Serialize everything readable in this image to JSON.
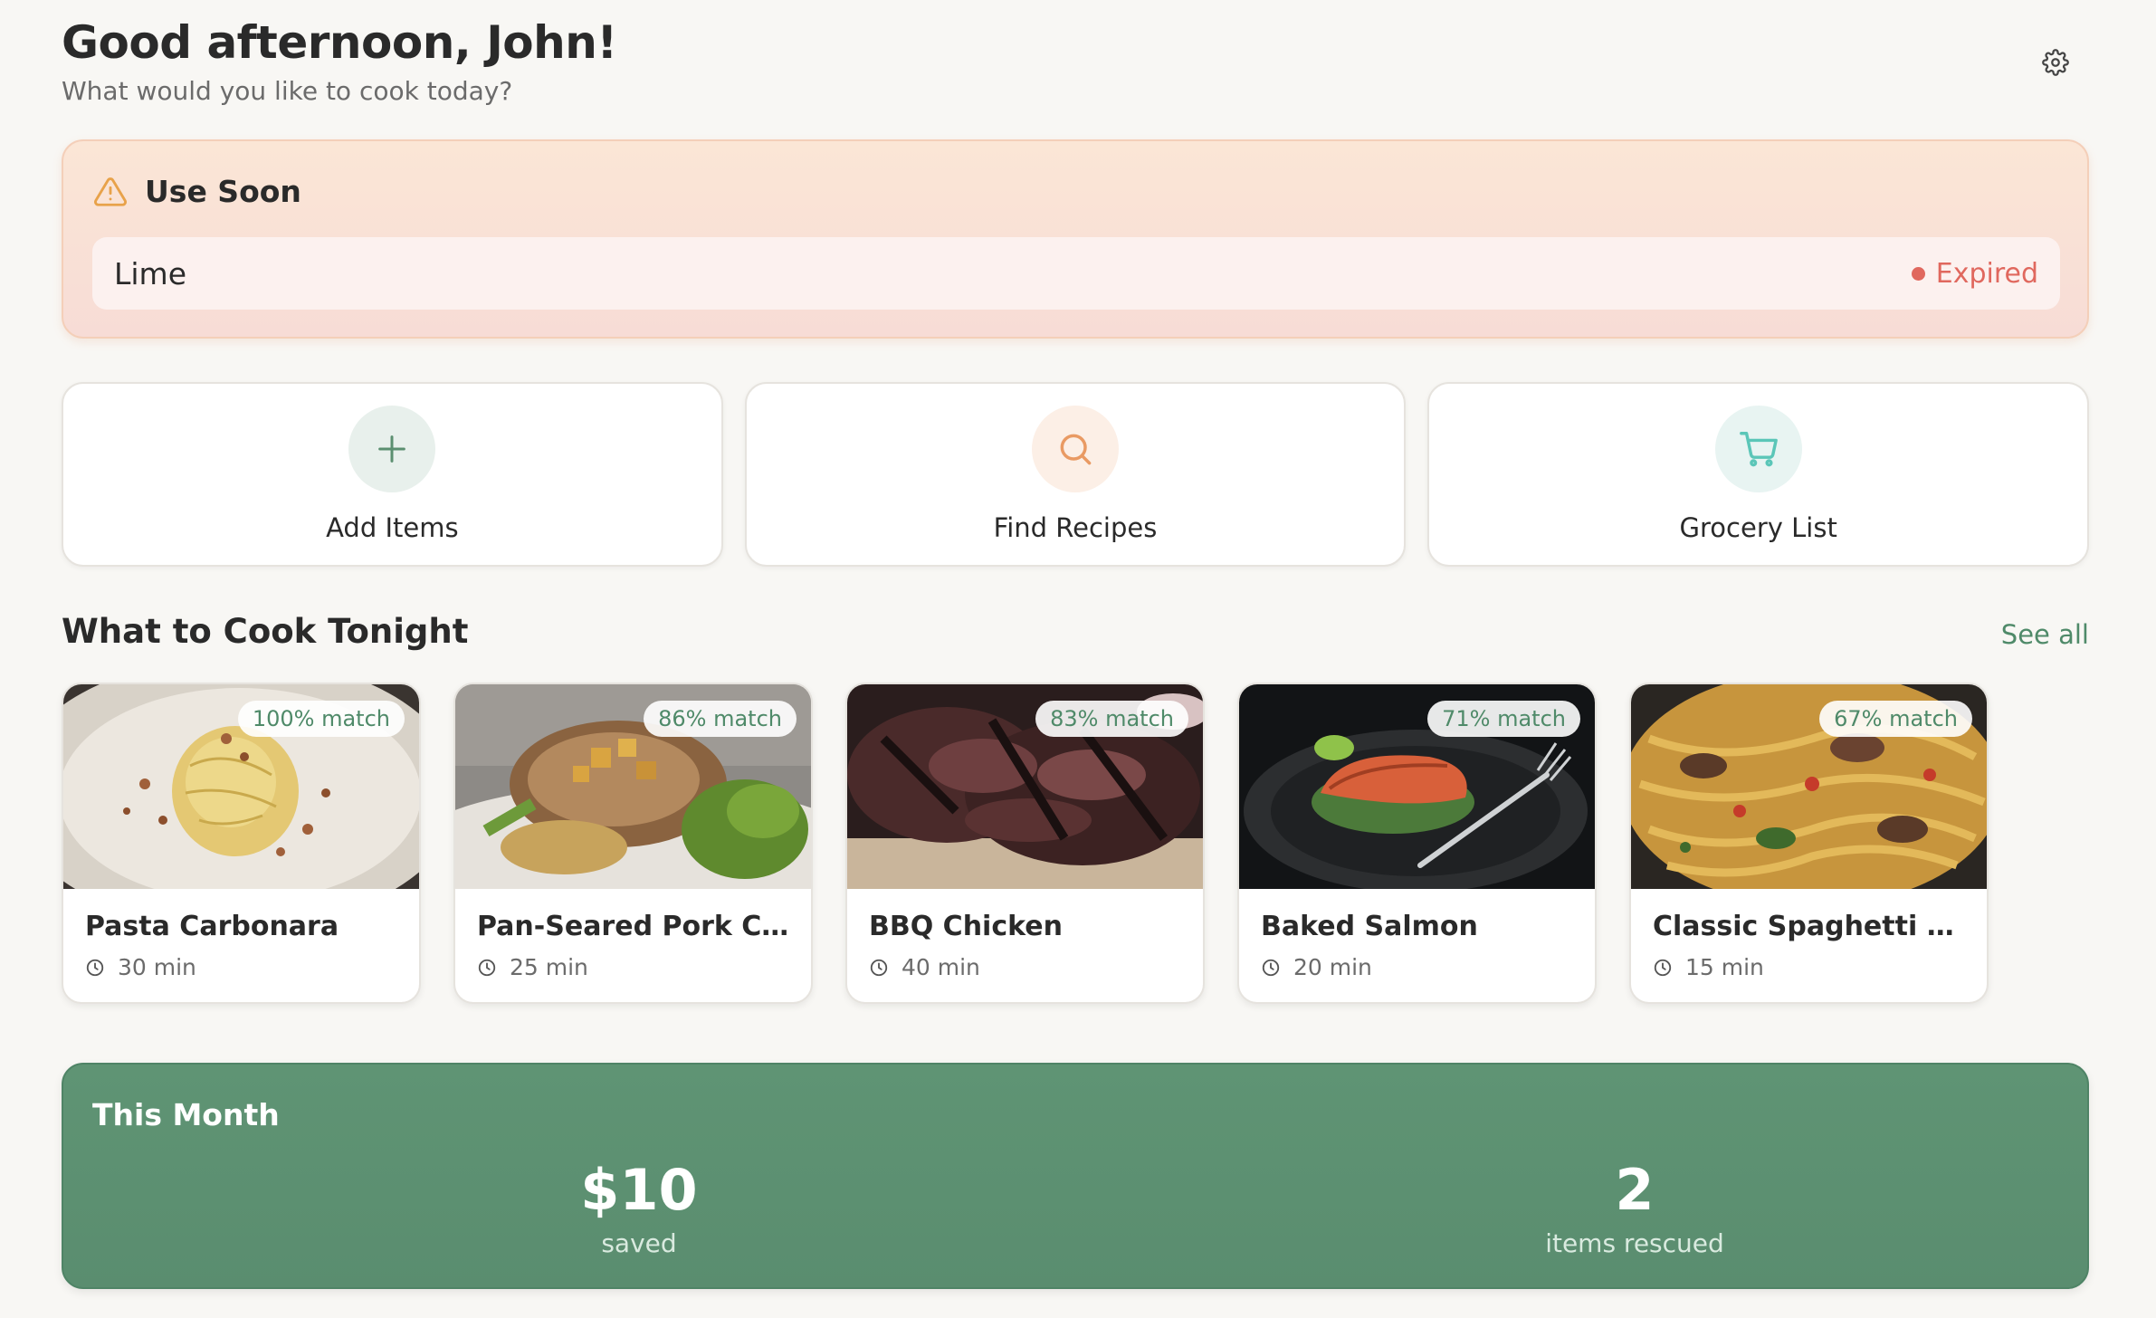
{
  "header": {
    "greeting": "Good afternoon, John!",
    "subtitle": "What would you like to cook today?"
  },
  "use_soon": {
    "title": "Use Soon",
    "items": [
      {
        "name": "Lime",
        "status": "Expired",
        "status_color": "#e0685e"
      }
    ]
  },
  "actions": [
    {
      "label": "Add Items",
      "icon": "plus-icon",
      "bg": "#e8f0ec",
      "color": "#5b8f70"
    },
    {
      "label": "Find Recipes",
      "icon": "search-icon",
      "bg": "#fcefe6",
      "color": "#e99a63"
    },
    {
      "label": "Grocery List",
      "icon": "cart-icon",
      "bg": "#e8f4f2",
      "color": "#5bc6b8"
    }
  ],
  "section": {
    "title": "What to Cook Tonight",
    "see_all": "See all"
  },
  "recipes": [
    {
      "name": "Pasta Carbonara",
      "time": "30 min",
      "match": "100% match"
    },
    {
      "name": "Pan-Seared Pork Chops",
      "time": "25 min",
      "match": "86% match"
    },
    {
      "name": "BBQ Chicken",
      "time": "40 min",
      "match": "83% match"
    },
    {
      "name": "Baked Salmon",
      "time": "20 min",
      "match": "71% match"
    },
    {
      "name": "Classic Spaghetti Aglio…",
      "time": "15 min",
      "match": "67% match"
    }
  ],
  "month": {
    "title": "This Month",
    "saved_value": "$10",
    "saved_label": "saved",
    "rescued_value": "2",
    "rescued_label": "items rescued"
  },
  "colors": {
    "accent_green": "#4f8a69",
    "warning_orange": "#e8a24a",
    "expired_red": "#e0685e"
  }
}
